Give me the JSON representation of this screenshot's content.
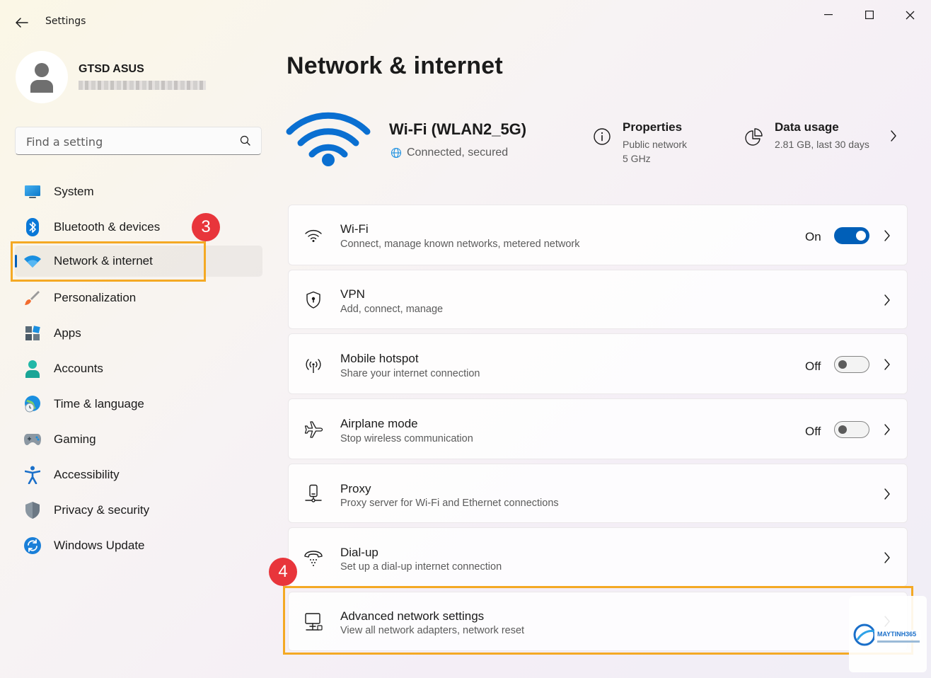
{
  "window": {
    "app_title": "Settings",
    "controls": {
      "minimize_icon": "minimize-icon",
      "maximize_icon": "maximize-icon",
      "close_icon": "close-icon"
    }
  },
  "profile": {
    "name": "GTSD ASUS",
    "email": "•••••••••••"
  },
  "search": {
    "placeholder": "Find a setting",
    "value": ""
  },
  "sidebar": {
    "items": [
      {
        "label": "System",
        "icon": "system-icon"
      },
      {
        "label": "Bluetooth & devices",
        "icon": "bluetooth-icon"
      },
      {
        "label": "Network & internet",
        "icon": "wifi-icon",
        "active": true
      },
      {
        "label": "Personalization",
        "icon": "brush-icon"
      },
      {
        "label": "Apps",
        "icon": "apps-icon"
      },
      {
        "label": "Accounts",
        "icon": "accounts-icon"
      },
      {
        "label": "Time & language",
        "icon": "globe-clock-icon"
      },
      {
        "label": "Gaming",
        "icon": "gamepad-icon"
      },
      {
        "label": "Accessibility",
        "icon": "accessibility-icon"
      },
      {
        "label": "Privacy & security",
        "icon": "shield-icon"
      },
      {
        "label": "Windows Update",
        "icon": "update-icon"
      }
    ]
  },
  "main": {
    "title": "Network & internet",
    "connection": {
      "name": "Wi-Fi (WLAN2_5G)",
      "status": "Connected, secured"
    },
    "properties": {
      "title": "Properties",
      "line1": "Public network",
      "line2": "5 GHz"
    },
    "data_usage": {
      "title": "Data usage",
      "value": "2.81 GB, last 30 days"
    },
    "cards": [
      {
        "title": "Wi-Fi",
        "sub": "Connect, manage known networks, metered network",
        "icon": "wifi-icon",
        "toggle_label": "On",
        "toggle": "on"
      },
      {
        "title": "VPN",
        "sub": "Add, connect, manage",
        "icon": "vpn-shield-icon"
      },
      {
        "title": "Mobile hotspot",
        "sub": "Share your internet connection",
        "icon": "hotspot-icon",
        "toggle_label": "Off",
        "toggle": "off"
      },
      {
        "title": "Airplane mode",
        "sub": "Stop wireless communication",
        "icon": "airplane-icon",
        "toggle_label": "Off",
        "toggle": "off"
      },
      {
        "title": "Proxy",
        "sub": "Proxy server for Wi-Fi and Ethernet connections",
        "icon": "proxy-icon"
      },
      {
        "title": "Dial-up",
        "sub": "Set up a dial-up internet connection",
        "icon": "dialup-icon"
      },
      {
        "title": "Advanced network settings",
        "sub": "View all network adapters, network reset",
        "icon": "network-computer-icon"
      }
    ]
  },
  "annotations": {
    "step3": "3",
    "step4": "4",
    "highlight_color": "#f4a924",
    "badge_color": "#e8353b"
  },
  "watermark": {
    "brand": "MAYTINH365"
  },
  "colors": {
    "accent": "#005fb8"
  }
}
